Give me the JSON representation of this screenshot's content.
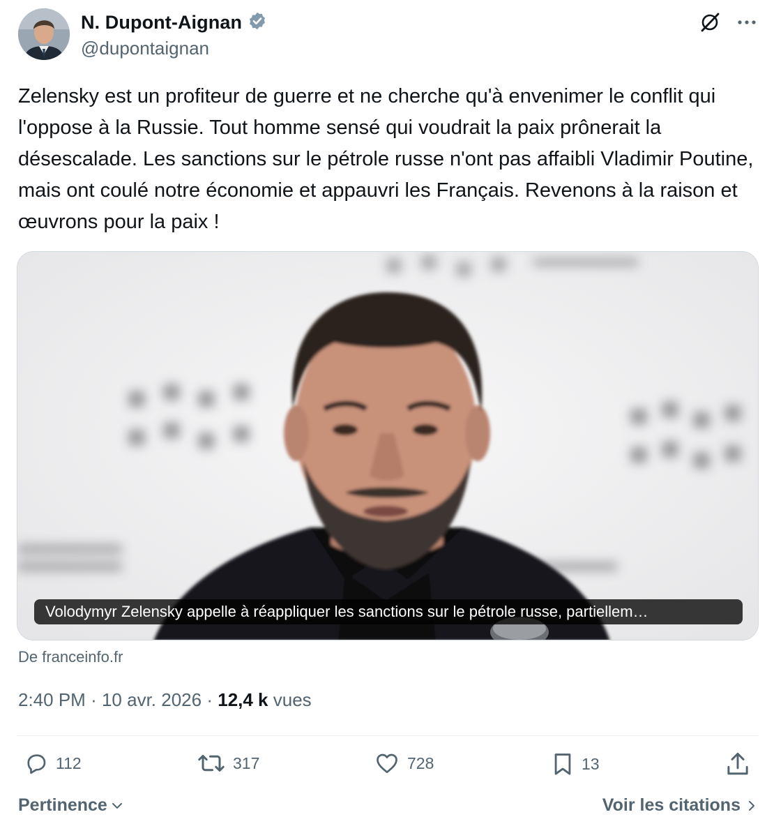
{
  "author": {
    "name": "N. Dupont-Aignan",
    "handle": "@dupontaignan",
    "verified": true,
    "verified_color": "#829aab"
  },
  "tweet": {
    "text": "Zelensky est un profiteur de guerre et ne cherche qu'à envenimer le conflit qui l'oppose à la Russie. Tout homme sensé qui voudrait la paix prônerait la désescalade. Les sanctions sur le pétrole russe n'ont pas affaibli Vladimir Poutine, mais ont coulé notre économie et appauvri les Français. Revenons à la raison et œuvrons pour la paix !"
  },
  "card": {
    "caption": "Volodymyr Zelensky appelle à réappliquer les sanctions sur le pétrole russe, partiellem…",
    "source": "De franceinfo.fr"
  },
  "meta": {
    "time": "2:40 PM",
    "separator": "·",
    "date": "10 avr. 2026",
    "views_count": "12,4 k",
    "views_label": "vues"
  },
  "actions": {
    "replies": "112",
    "reposts": "317",
    "likes": "728",
    "bookmarks": "13"
  },
  "footer": {
    "sort_label": "Pertinence",
    "quotes_label": "Voir les citations"
  },
  "icons": {
    "header": [
      "grok-icon",
      "more-icon"
    ],
    "actions": [
      "reply-icon",
      "repost-icon",
      "like-icon",
      "bookmark-icon",
      "share-icon"
    ],
    "footer": [
      "chevron-down-icon",
      "chevron-right-icon"
    ]
  },
  "colors": {
    "text_primary": "#0f1419",
    "text_secondary": "#536471",
    "border": "#cfd9de"
  }
}
